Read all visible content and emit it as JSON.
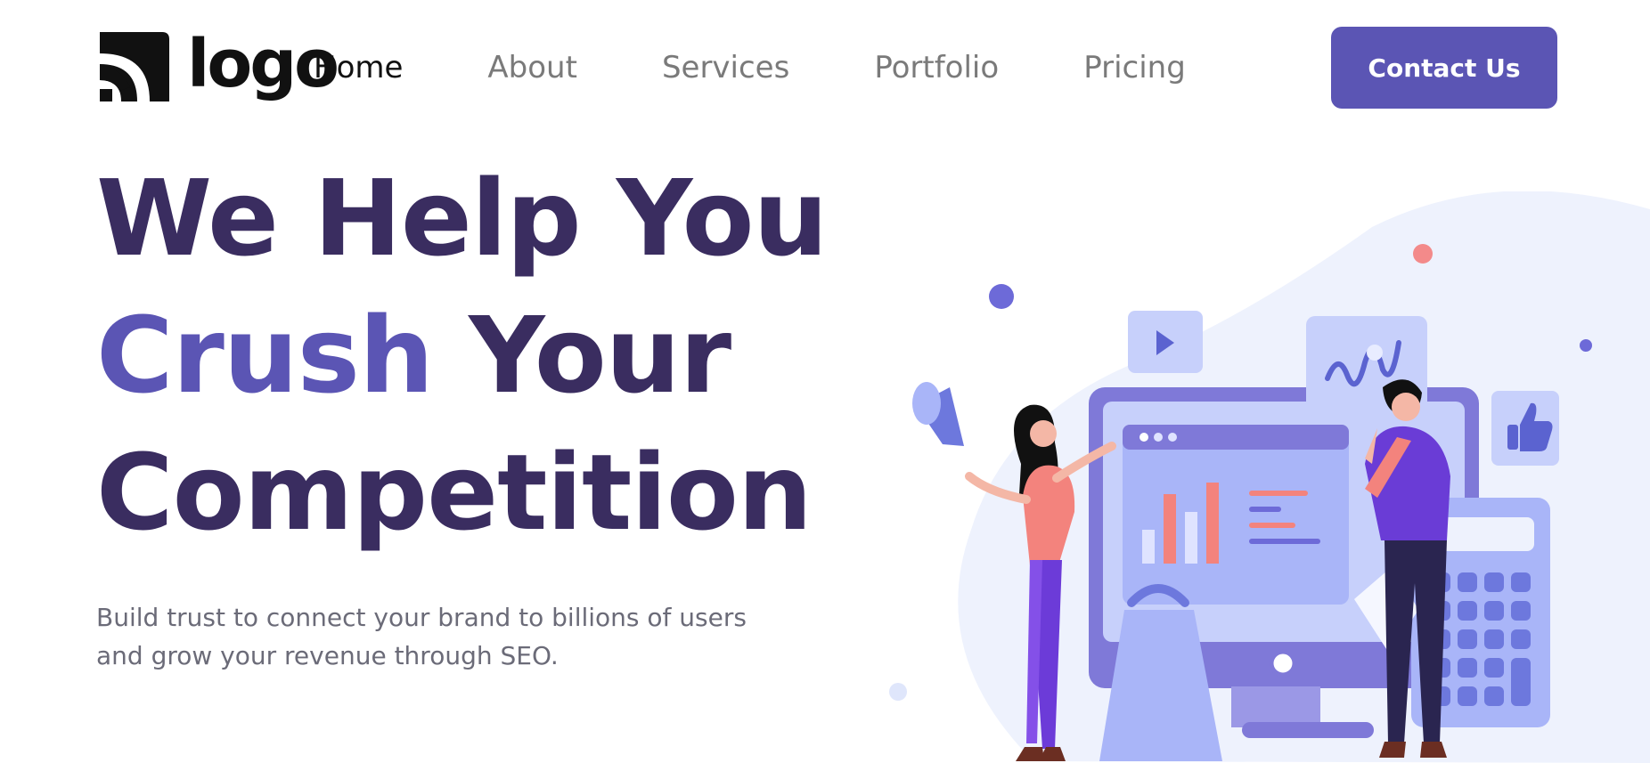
{
  "header": {
    "logo_text": "logo",
    "nav": [
      {
        "label": "Home",
        "active": true
      },
      {
        "label": "About",
        "active": false
      },
      {
        "label": "Services",
        "active": false
      },
      {
        "label": "Portfolio",
        "active": false
      },
      {
        "label": "Pricing",
        "active": false
      }
    ],
    "cta_label": "Contact Us"
  },
  "hero": {
    "title_line1": "We Help You",
    "title_accent": "Crush",
    "title_line2_rest": " Your",
    "title_line3": "Competition",
    "description": "Build trust to connect your brand to billions of users and grow your revenue through SEO."
  },
  "colors": {
    "accent": "#5b55b4",
    "heading": "#3a2d60",
    "body_text": "#6b6b78",
    "nav_text": "#7a7a7a"
  },
  "illustration": {
    "subject": "digital-marketing-scene",
    "icons": [
      "megaphone-icon",
      "play-icon",
      "chart-wave-icon",
      "thumbs-up-icon",
      "bar-chart-icon",
      "shopping-bag-icon",
      "calculator-icon"
    ]
  }
}
